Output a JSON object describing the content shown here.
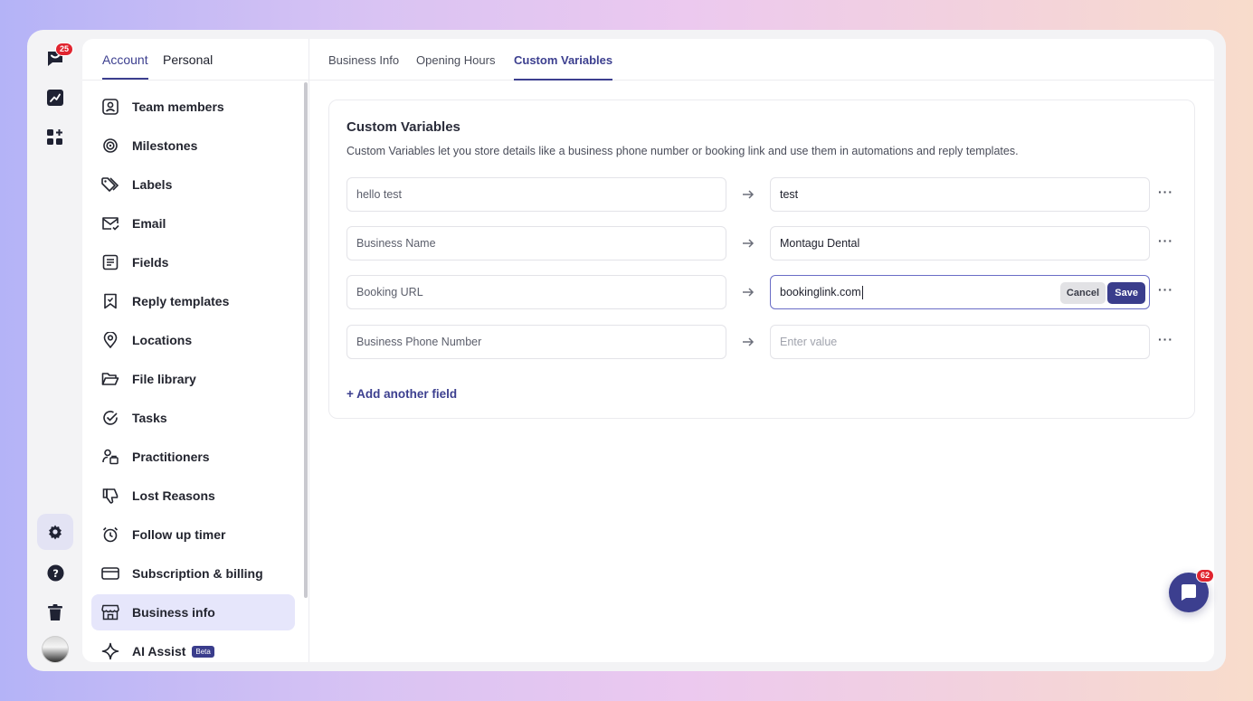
{
  "rail": {
    "notification_count": "25",
    "items": [
      "inbox-icon",
      "analytics-icon",
      "apps-add-icon"
    ],
    "bottom": [
      "settings-icon",
      "help-icon",
      "trash-icon"
    ]
  },
  "sidebar": {
    "tabs": [
      "Account",
      "Personal"
    ],
    "items": [
      {
        "label": "Team members",
        "icon": "user-square-icon"
      },
      {
        "label": "Milestones",
        "icon": "target-icon"
      },
      {
        "label": "Labels",
        "icon": "tag-icon"
      },
      {
        "label": "Email",
        "icon": "mail-check-icon"
      },
      {
        "label": "Fields",
        "icon": "form-icon"
      },
      {
        "label": "Reply templates",
        "icon": "bookmark-icon"
      },
      {
        "label": "Locations",
        "icon": "map-pin-icon"
      },
      {
        "label": "File library",
        "icon": "folder-open-icon"
      },
      {
        "label": "Tasks",
        "icon": "check-circle-icon"
      },
      {
        "label": "Practitioners",
        "icon": "user-id-icon"
      },
      {
        "label": "Lost Reasons",
        "icon": "thumbs-down-icon"
      },
      {
        "label": "Follow up timer",
        "icon": "alarm-clock-icon"
      },
      {
        "label": "Subscription & billing",
        "icon": "credit-card-icon"
      },
      {
        "label": "Business info",
        "icon": "store-icon"
      },
      {
        "label": "AI Assist",
        "icon": "sparkle-icon",
        "badge": "Beta"
      }
    ]
  },
  "main": {
    "tabs": [
      "Business Info",
      "Opening Hours",
      "Custom Variables"
    ],
    "card": {
      "title": "Custom Variables",
      "description": "Custom Variables let you store details like a business phone number or booking link and use them in automations and reply templates.",
      "rows": [
        {
          "key": "hello test",
          "value": "test"
        },
        {
          "key": "Business Name",
          "value": "Montagu Dental"
        },
        {
          "key": "Booking URL",
          "value": "bookinglink.com",
          "cancel": "Cancel",
          "save": "Save"
        },
        {
          "key": "Business Phone Number",
          "placeholder": "Enter value"
        }
      ],
      "more": "···",
      "add_field": "+ Add another field"
    }
  },
  "chat": {
    "unread": "62"
  },
  "colors": {
    "accent": "#3c3f8f",
    "badge": "#e0242f",
    "active_bg": "#e6e6fb"
  }
}
